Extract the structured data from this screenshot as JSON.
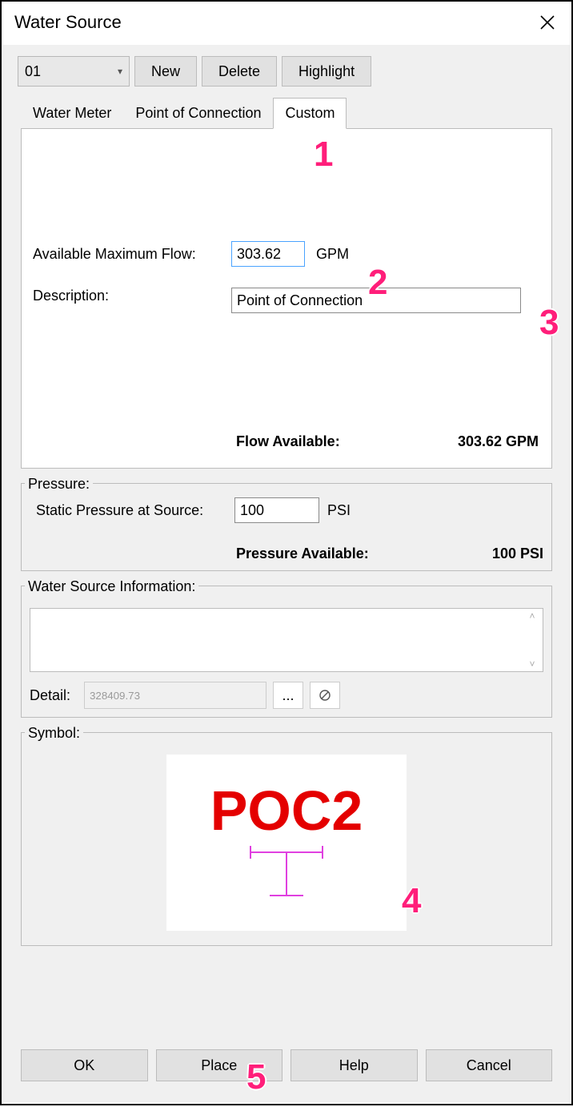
{
  "window": {
    "title": "Water Source"
  },
  "selector": {
    "value": "01"
  },
  "buttons": {
    "new": "New",
    "delete": "Delete",
    "highlight": "Highlight"
  },
  "tabs": {
    "meter": "Water Meter",
    "poc": "Point of Connection",
    "custom": "Custom"
  },
  "flow": {
    "label": "Available Maximum Flow:",
    "value": "303.62",
    "unit": "GPM",
    "desc_label": "Description:",
    "desc_value": "Point of Connection",
    "avail_label": "Flow Available:",
    "avail_value": "303.62 GPM"
  },
  "pressure": {
    "legend": "Pressure:",
    "static_label": "Static Pressure at Source:",
    "static_value": "100",
    "unit": "PSI",
    "avail_label": "Pressure Available:",
    "avail_value": "100 PSI"
  },
  "info": {
    "legend": "Water Source Information:",
    "text": "",
    "detail_label": "Detail:",
    "detail_value": "328409.73",
    "browse": "..."
  },
  "symbol": {
    "legend": "Symbol:",
    "text": "POC2"
  },
  "footer": {
    "ok": "OK",
    "place": "Place",
    "help": "Help",
    "cancel": "Cancel"
  },
  "markers": {
    "m1": "1",
    "m2": "2",
    "m3": "3",
    "m4": "4",
    "m5": "5"
  }
}
